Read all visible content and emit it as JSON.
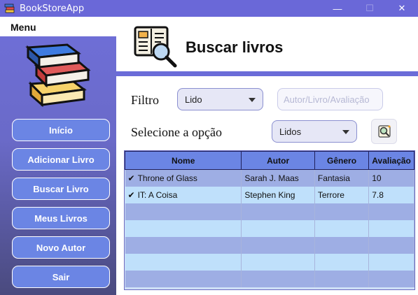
{
  "window": {
    "title": "BookStoreApp",
    "controls": {
      "minimize": "—",
      "maximize": "☐",
      "close": "✕"
    }
  },
  "menu": {
    "label": "Menu"
  },
  "sidebar": {
    "logo_icon": "stacked-books-icon",
    "items": [
      {
        "label": "Início"
      },
      {
        "label": "Adicionar Livro"
      },
      {
        "label": "Buscar Livro"
      },
      {
        "label": "Meus Livros"
      },
      {
        "label": "Novo Autor"
      },
      {
        "label": "Sair"
      }
    ]
  },
  "header": {
    "icon": "book-search-icon",
    "title": "Buscar livros"
  },
  "filter": {
    "label": "Filtro",
    "selected": "Lido",
    "search_placeholder": "Autor/Livro/Avaliação"
  },
  "option": {
    "label": "Selecione a opção",
    "selected": "Lidos"
  },
  "table": {
    "columns": [
      "Nome",
      "Autor",
      "Gênero",
      "Avaliação"
    ],
    "rows": [
      {
        "check": "✔",
        "nome": "Throne of Glass",
        "autor": "Sarah J. Maas",
        "genero": "Fantasia",
        "avaliacao": "10"
      },
      {
        "check": "✔",
        "nome": "IT: A Coisa",
        "autor": "Stephen King",
        "genero": "Terrore",
        "avaliacao": "7.8"
      }
    ]
  },
  "colors": {
    "accent": "#6a68d8",
    "button": "#6b85e4",
    "row_odd": "#9eaee4",
    "row_even": "#bfe0fb"
  }
}
